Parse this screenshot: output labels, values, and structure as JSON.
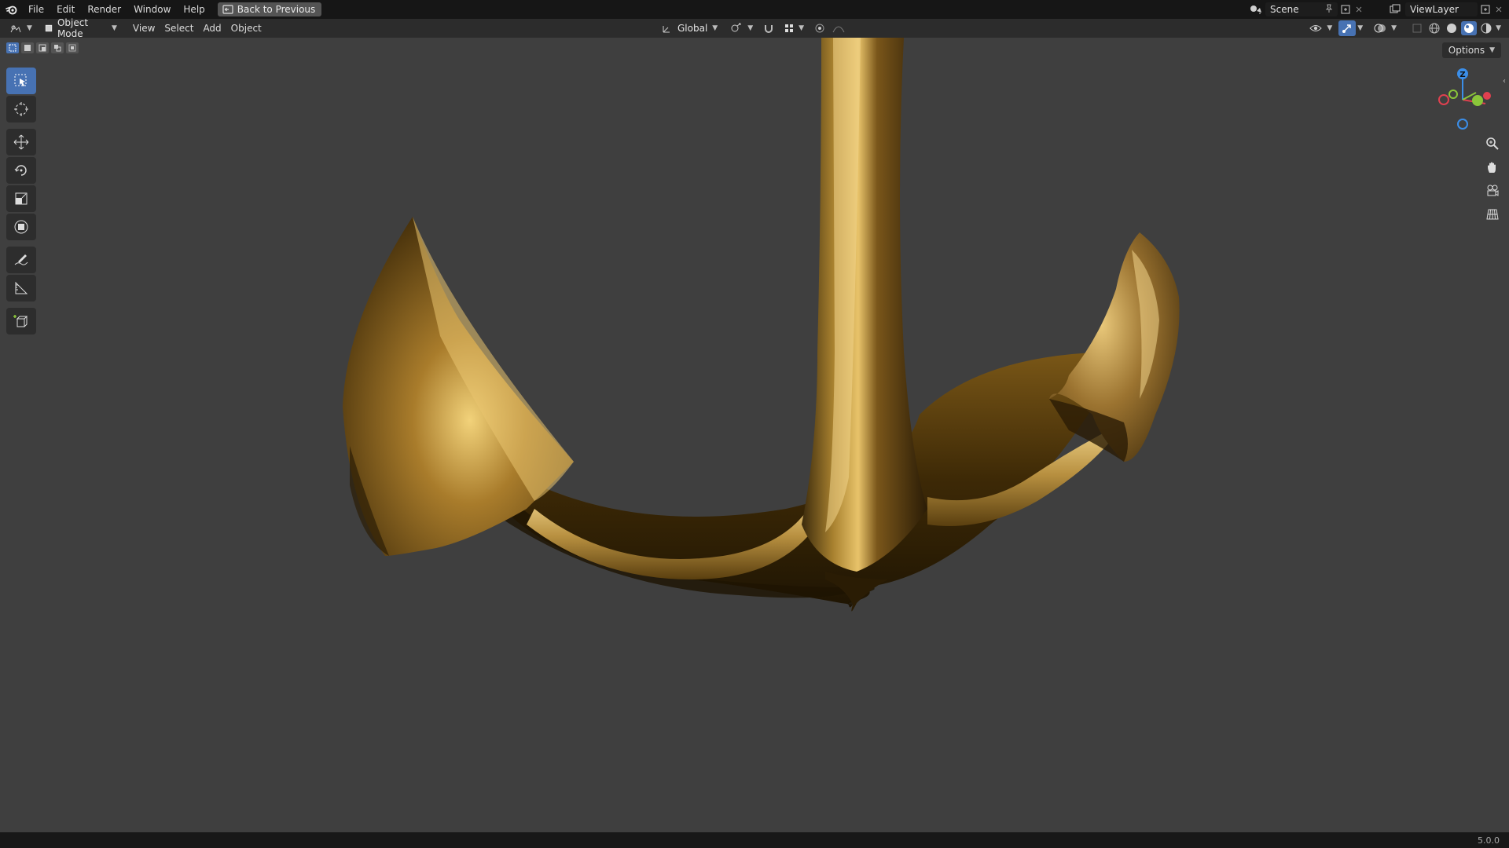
{
  "topbar": {
    "menu": [
      "File",
      "Edit",
      "Render",
      "Window",
      "Help"
    ],
    "back_label": "Back to Previous",
    "scene_label": "Scene",
    "viewlayer_label": "ViewLayer"
  },
  "header": {
    "mode_label": "Object Mode",
    "menu": [
      "View",
      "Select",
      "Add",
      "Object"
    ],
    "transform_orientation": "Global",
    "options_label": "Options"
  },
  "gizmo": {
    "z_label": "Z",
    "y_label": "Y",
    "x_label": "X",
    "colors": {
      "x": "#e0404f",
      "y": "#8ac53a",
      "z": "#3b8ee8"
    }
  },
  "tools": [
    "select-box-icon",
    "cursor-icon",
    "move-icon",
    "rotate-icon",
    "scale-icon",
    "transform-icon",
    "annotate-icon",
    "measure-icon",
    "add-cube-icon"
  ],
  "status": {
    "version": "5.0.0"
  },
  "accent": "#4772b3"
}
